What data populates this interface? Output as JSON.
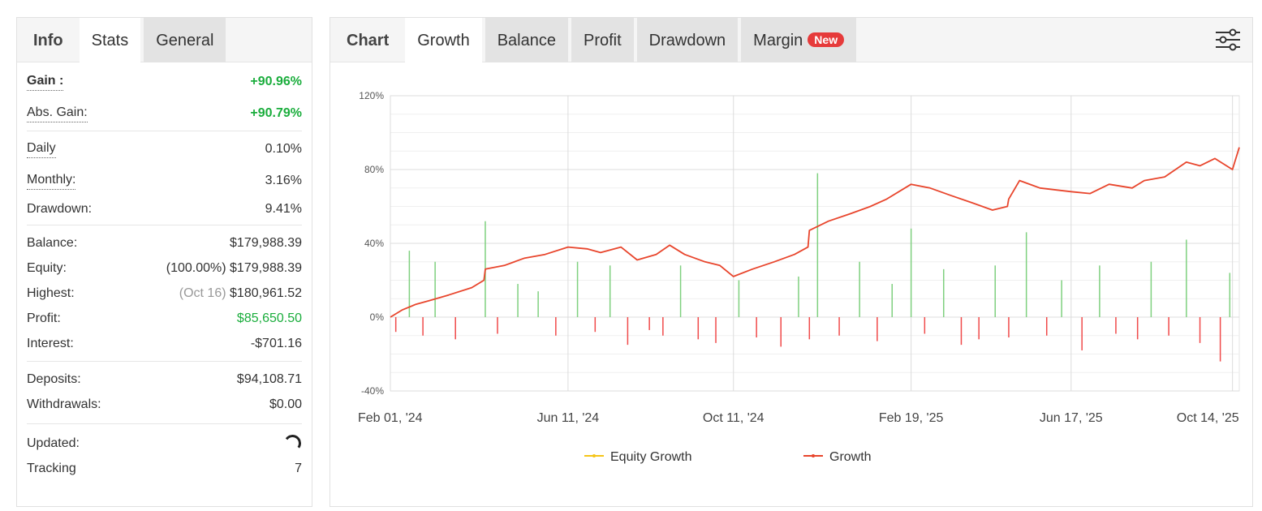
{
  "stats_panel": {
    "tabs": {
      "info": "Info",
      "stats": "Stats",
      "general": "General"
    },
    "gain": {
      "label": "Gain :",
      "value": "+90.96%"
    },
    "abs_gain": {
      "label": "Abs. Gain:",
      "value": "+90.79%"
    },
    "daily": {
      "label": "Daily",
      "value": "0.10%"
    },
    "monthly": {
      "label": "Monthly:",
      "value": "3.16%"
    },
    "drawdown": {
      "label": "Drawdown:",
      "value": "9.41%"
    },
    "balance": {
      "label": "Balance:",
      "value": "$179,988.39"
    },
    "equity": {
      "label": "Equity:",
      "pct": "(100.00%)",
      "value": "$179,988.39"
    },
    "highest": {
      "label": "Highest:",
      "date": "(Oct 16)",
      "value": "$180,961.52"
    },
    "profit": {
      "label": "Profit:",
      "value": "$85,650.50"
    },
    "interest": {
      "label": "Interest:",
      "value": "-$701.16"
    },
    "deposits": {
      "label": "Deposits:",
      "value": "$94,108.71"
    },
    "withdrawals": {
      "label": "Withdrawals:",
      "value": "$0.00"
    },
    "updated": {
      "label": "Updated:"
    },
    "tracking": {
      "label": "Tracking",
      "value": "7"
    }
  },
  "chart_panel": {
    "tabs": {
      "chart": "Chart",
      "growth": "Growth",
      "balance": "Balance",
      "profit": "Profit",
      "drawdown": "Drawdown",
      "margin": "Margin",
      "new_badge": "New"
    },
    "settings_icon": "sliders-icon"
  },
  "colors": {
    "growth_line": "#e8452c",
    "equity_line": "#f5c518",
    "positive_bar": "#7fd07f",
    "negative_bar": "#f04a4a",
    "gain_text": "#1aad3c",
    "badge": "#e63a3a"
  },
  "chart_data": {
    "type": "line",
    "title": "",
    "xlabel": "",
    "ylabel": "",
    "y_ticks": [
      "120%",
      "80%",
      "40%",
      "0%",
      "-40%"
    ],
    "y_tick_values": [
      120,
      80,
      40,
      0,
      -40
    ],
    "ylim": [
      -40,
      120
    ],
    "x_ticks": [
      "Feb 01, '24",
      "Jun 11, '24",
      "Oct 11, '24",
      "Feb 19, '25",
      "Jun 17, '25",
      "Oct 14, '25"
    ],
    "x_tick_dates": [
      "2024-02-01",
      "2024-06-11",
      "2024-10-11",
      "2025-02-19",
      "2025-06-17",
      "2025-10-14"
    ],
    "x_range": [
      "2024-02-01",
      "2025-10-19"
    ],
    "grid": true,
    "legend": [
      "Equity Growth",
      "Growth"
    ],
    "legend_position": "bottom-center",
    "series": [
      {
        "name": "Growth",
        "x": [
          "2024-02-01",
          "2024-02-10",
          "2024-02-20",
          "2024-03-01",
          "2024-03-15",
          "2024-04-01",
          "2024-04-10",
          "2024-04-11",
          "2024-04-25",
          "2024-05-10",
          "2024-05-25",
          "2024-06-11",
          "2024-06-25",
          "2024-07-05",
          "2024-07-20",
          "2024-08-01",
          "2024-08-15",
          "2024-08-25",
          "2024-09-05",
          "2024-09-20",
          "2024-10-01",
          "2024-10-11",
          "2024-10-25",
          "2024-11-10",
          "2024-11-25",
          "2024-12-05",
          "2024-12-06",
          "2024-12-20",
          "2025-01-05",
          "2025-01-20",
          "2025-02-01",
          "2025-02-19",
          "2025-03-05",
          "2025-03-20",
          "2025-04-05",
          "2025-04-20",
          "2025-05-01",
          "2025-05-02",
          "2025-05-10",
          "2025-05-25",
          "2025-06-17",
          "2025-07-01",
          "2025-07-15",
          "2025-08-01",
          "2025-08-10",
          "2025-08-25",
          "2025-09-10",
          "2025-09-20",
          "2025-10-01",
          "2025-10-14",
          "2025-10-19"
        ],
        "y": [
          0,
          4,
          7,
          9,
          12,
          16,
          20,
          26,
          28,
          32,
          34,
          38,
          37,
          35,
          38,
          31,
          34,
          39,
          34,
          30,
          28,
          22,
          26,
          30,
          34,
          38,
          47,
          52,
          56,
          60,
          64,
          72,
          70,
          66,
          62,
          58,
          60,
          64,
          74,
          70,
          68,
          67,
          72,
          70,
          74,
          76,
          84,
          82,
          86,
          80,
          92
        ]
      },
      {
        "name": "Equity Growth",
        "x": [
          "2024-02-01",
          "2025-10-19"
        ],
        "y": [
          0,
          92
        ]
      }
    ],
    "daily_bars": {
      "x": [
        "2024-02-05",
        "2024-02-15",
        "2024-02-25",
        "2024-03-05",
        "2024-03-20",
        "2024-04-11",
        "2024-04-20",
        "2024-05-05",
        "2024-05-20",
        "2024-06-02",
        "2024-06-18",
        "2024-07-01",
        "2024-07-12",
        "2024-07-25",
        "2024-08-10",
        "2024-08-20",
        "2024-09-02",
        "2024-09-15",
        "2024-09-28",
        "2024-10-15",
        "2024-10-28",
        "2024-11-15",
        "2024-11-28",
        "2024-12-06",
        "2024-12-12",
        "2024-12-28",
        "2025-01-12",
        "2025-01-25",
        "2025-02-05",
        "2025-02-19",
        "2025-03-01",
        "2025-03-15",
        "2025-03-28",
        "2025-04-10",
        "2025-04-22",
        "2025-05-02",
        "2025-05-15",
        "2025-05-30",
        "2025-06-10",
        "2025-06-25",
        "2025-07-08",
        "2025-07-20",
        "2025-08-05",
        "2025-08-15",
        "2025-08-28",
        "2025-09-10",
        "2025-09-20",
        "2025-10-05",
        "2025-10-12"
      ],
      "values": [
        -8,
        36,
        -10,
        30,
        -12,
        52,
        -9,
        18,
        14,
        -10,
        30,
        -8,
        28,
        -15,
        -7,
        -10,
        28,
        -12,
        -14,
        20,
        -11,
        -16,
        22,
        -12,
        78,
        -10,
        30,
        -13,
        18,
        48,
        -9,
        26,
        -15,
        -12,
        28,
        -11,
        46,
        -10,
        20,
        -18,
        28,
        -9,
        -12,
        30,
        -10,
        42,
        -14,
        -24,
        24
      ]
    }
  }
}
